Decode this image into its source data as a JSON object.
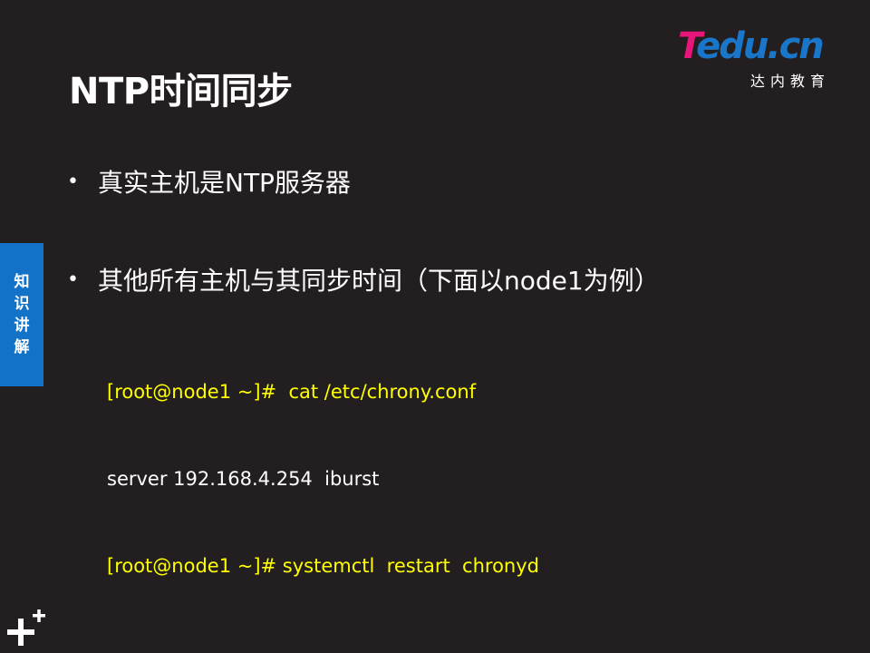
{
  "slide": {
    "title": "NTP时间同步",
    "logo": {
      "brand_t": "T",
      "brand_rest": "edu.cn",
      "subtitle": "达内教育"
    },
    "side_tab": [
      "知",
      "识",
      "讲",
      "解"
    ],
    "bullets": [
      "真实主机是NTP服务器",
      "其他所有主机与其同步时间（下面以node1为例）"
    ],
    "code_lines": [
      {
        "text": "[root@node1 ~]#  cat /etc/chrony.conf",
        "color": "#ffff00"
      },
      {
        "text": "server 192.168.4.254  iburst",
        "color": "#ffffff"
      },
      {
        "text": "[root@node1 ~]# systemctl  restart  chronyd",
        "color": "#ffff00"
      }
    ],
    "colors": {
      "background": "#231f20",
      "accent_blue": "#1272c8",
      "logo_pink": "#e8157a",
      "code_highlight": "#ffff00"
    }
  }
}
